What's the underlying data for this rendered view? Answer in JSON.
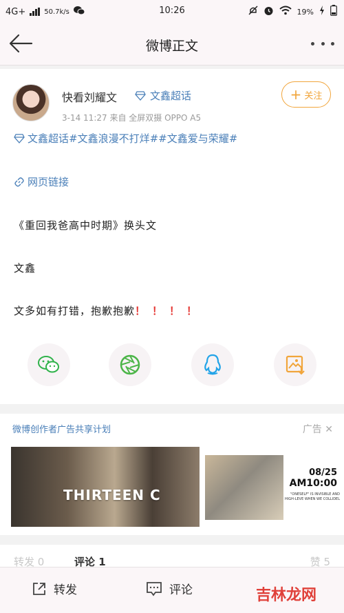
{
  "status_bar": {
    "network": "4G+",
    "speed": "50.7k/s",
    "time": "10:26",
    "battery": "19%"
  },
  "nav": {
    "title": "微博正文"
  },
  "post": {
    "author": "快看刘耀文",
    "author_tag": "文鑫超话",
    "meta": "3-14 11:27  来自 全屏双摄 OPPO A5",
    "follow_label": "关注",
    "topics": "文鑫超话#文鑫浪漫不打烊##文鑫爱与荣耀#",
    "web_link": "网页链接",
    "lines": [
      "《重回我爸高中时期》换头文",
      "文鑫",
      "文多如有打错，抱歉抱歉"
    ],
    "exclaim": "！！！！"
  },
  "share": [
    "wechat-icon",
    "moments-icon",
    "qq-icon",
    "save-image-icon"
  ],
  "ad": {
    "header": "微博创作者广告共享计划",
    "label": "广告",
    "brand": "THIRTEEN C",
    "date": "08/25",
    "time": "AM10:00",
    "fine_print": "\"ONESELF\" IS INVISIBLE AND HIGH-LEVE WHEN WE COLLIDEL"
  },
  "comments": {
    "left_faded": "转发 0",
    "mid": "评论 1",
    "right_faded": "赞 5"
  },
  "bottom_bar": {
    "repost_label": "转发",
    "comment_label": "评论",
    "watermark": "吉林龙网"
  },
  "colors": {
    "link": "#4a7fb8",
    "follow": "#f1a53b",
    "wechat": "#2fb24a",
    "qq": "#23a4e8",
    "save": "#f1a53b",
    "exclaim": "#e53935"
  }
}
